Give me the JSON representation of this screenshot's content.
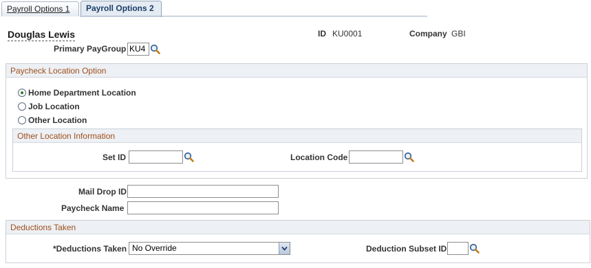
{
  "tabs": [
    {
      "label": "Payroll Options 1",
      "active": false
    },
    {
      "label": "Payroll Options 2",
      "active": true
    }
  ],
  "employee": {
    "name": "Douglas Lewis",
    "id_label": "ID",
    "id_value": "KU0001",
    "company_label": "Company",
    "company_value": "GBI"
  },
  "primary_paygroup": {
    "label": "Primary PayGroup",
    "value": "KU4",
    "lookup_icon": "magnifier-icon"
  },
  "paycheck_location": {
    "title": "Paycheck Location Option",
    "options": [
      {
        "label": "Home Department Location",
        "selected": true
      },
      {
        "label": "Job Location",
        "selected": false
      },
      {
        "label": "Other Location",
        "selected": false
      }
    ],
    "other_location": {
      "title": "Other Location Information",
      "set_id_label": "Set ID",
      "set_id_value": "",
      "location_code_label": "Location Code",
      "location_code_value": ""
    }
  },
  "mail_drop": {
    "label": "Mail Drop ID",
    "value": ""
  },
  "paycheck_name": {
    "label": "Paycheck Name",
    "value": ""
  },
  "deductions": {
    "title": "Deductions Taken",
    "taken_label": "*Deductions Taken",
    "taken_value": "No Override",
    "subset_label": "Deduction Subset ID",
    "subset_value": ""
  },
  "colors": {
    "group_title": "#9e4f1c",
    "group_header_bg": "#edf0f4",
    "tab_active_text": "#1a3e67"
  }
}
